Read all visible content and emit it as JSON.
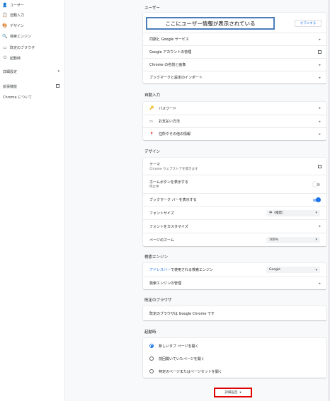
{
  "sidebar": {
    "items": [
      {
        "icon": "person-icon",
        "glyph": "👤",
        "label": "ユーザー"
      },
      {
        "icon": "clipboard-icon",
        "glyph": "📋",
        "label": "自動入力"
      },
      {
        "icon": "palette-icon",
        "glyph": "🎨",
        "label": "デザイン"
      },
      {
        "icon": "search-icon",
        "glyph": "🔍",
        "label": "検索エンジン"
      },
      {
        "icon": "browser-icon",
        "glyph": "▭",
        "label": "既定のブラウザ"
      },
      {
        "icon": "power-icon",
        "glyph": "⏻",
        "label": "起動時"
      }
    ],
    "advanced_label": "詳細設定",
    "extensions_label": "拡張機能",
    "about_label": "Chrome について"
  },
  "people": {
    "title": "ユーザー",
    "callout_text": "ここにユーザー情報が表示されている",
    "signout_label": "オフにする",
    "rows": [
      "同期と Google サービス",
      "Google アカウントの管理",
      "Chrome の名前と画像",
      "ブックマークと設定のインポート"
    ]
  },
  "autofill": {
    "title": "自動入力",
    "rows": [
      {
        "icon": "key-icon",
        "glyph": "🔑",
        "label": "パスワード"
      },
      {
        "icon": "card-icon",
        "glyph": "▭",
        "label": "お支払い方法"
      },
      {
        "icon": "location-icon",
        "glyph": "📍",
        "label": "住所やその他の情報"
      }
    ]
  },
  "appearance": {
    "title": "デザイン",
    "theme_label": "テーマ",
    "theme_sub": "Chrome ウェブストアを開きます",
    "home_button_label": "ホームボタンを表示する",
    "home_button_sub": "停止中",
    "bookmarks_bar_label": "ブックマーク バーを表示する",
    "font_size_label": "フォントサイズ",
    "font_size_value": "中（推奨）",
    "customize_fonts_label": "フォントをカスタマイズ",
    "zoom_label": "ページのズーム",
    "zoom_value": "100%"
  },
  "search": {
    "title": "検索エンジン",
    "address_bar_link": "アドレスバー",
    "address_bar_text": "で使用される検索エンジン",
    "engine_value": "Google",
    "manage_label": "検索エンジンの管理"
  },
  "default_browser": {
    "title": "既定のブラウザ",
    "text": "既定のブラウザは Google Chrome です"
  },
  "startup": {
    "title": "起動時",
    "options": [
      "新しいタブ ページを開く",
      "前回開いていたページを開く",
      "特定のページまたはページセットを開く"
    ],
    "selected_index": 0
  },
  "advanced_button_label": "詳細設定",
  "colors": {
    "accent": "#1a73e8",
    "highlight_border": "#e00000",
    "callout_border": "#4a7ebb"
  }
}
